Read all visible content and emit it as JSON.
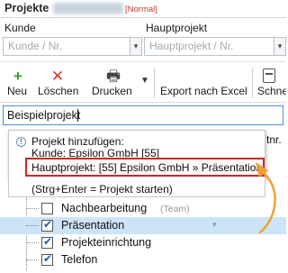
{
  "header": {
    "title": "Projekte",
    "mode_badge": "[Normal]"
  },
  "filters": {
    "kunde": {
      "label": "Kunde",
      "placeholder": "Kunde / Nr."
    },
    "hauptprojekt": {
      "label": "Hauptprojekt",
      "placeholder": "Hauptprojekt / Nr."
    }
  },
  "toolbar": {
    "new_label": "Neu",
    "delete_label": "Löschen",
    "print_label": "Drucken",
    "export_label": "Export nach Excel",
    "schnell_label": "Schnel"
  },
  "project_input": {
    "value": "Beispielprojekt"
  },
  "popup": {
    "line1": "Projekt hinzufügen:",
    "line2": "Kunde: Epsilon GmbH [55]",
    "line3": "Hauptprojekt: [55] Epsilon GmbH » Präsentation",
    "line4": "(Strg+Enter = Projekt starten)",
    "right_fragment": "tnr."
  },
  "list": [
    {
      "label": "Nachbearbeitung",
      "tag": "(Team)",
      "checked": false
    },
    {
      "label": "Präsentation",
      "tag": "",
      "checked": true
    },
    {
      "label": "Projekteinrichtung",
      "tag": "",
      "checked": true
    },
    {
      "label": "Telefon",
      "tag": "",
      "checked": true
    }
  ],
  "colors": {
    "accent_blue": "#4c8ed6",
    "selection": "#cde3f8",
    "highlight_border": "#c62828",
    "arrow": "#f0a030",
    "mode_red": "#c0392b"
  }
}
